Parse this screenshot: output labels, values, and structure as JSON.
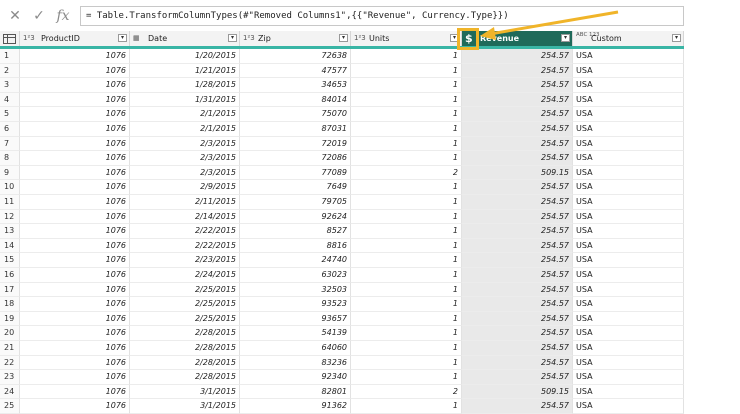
{
  "formula": {
    "cancel_glyph": "✕",
    "commit_glyph": "✓",
    "fx_label": "fx",
    "text": "= Table.TransformColumnTypes(#\"Removed Columns1\",{{\"Revenue\", Currency.Type}})"
  },
  "columns": [
    {
      "type_icon": "1²3",
      "name": "ProductID"
    },
    {
      "type_icon": "▦",
      "name": "Date"
    },
    {
      "type_icon": "1²3",
      "name": "Zip"
    },
    {
      "type_icon": "1²3",
      "name": "Units"
    },
    {
      "type_icon": "$",
      "name": "Revenue"
    },
    {
      "type_icon": "ABC 123",
      "name": "Custom"
    }
  ],
  "accent_color": "#39b5a5",
  "selected_header_color": "#1f6a5a",
  "callout_color": "#f0b429",
  "rows": [
    [
      "1",
      "1076",
      "1/20/2015",
      "72638",
      "1",
      "254.57",
      "USA"
    ],
    [
      "2",
      "1076",
      "1/21/2015",
      "47577",
      "1",
      "254.57",
      "USA"
    ],
    [
      "3",
      "1076",
      "1/28/2015",
      "34653",
      "1",
      "254.57",
      "USA"
    ],
    [
      "4",
      "1076",
      "1/31/2015",
      "84014",
      "1",
      "254.57",
      "USA"
    ],
    [
      "5",
      "1076",
      "2/1/2015",
      "75070",
      "1",
      "254.57",
      "USA"
    ],
    [
      "6",
      "1076",
      "2/1/2015",
      "87031",
      "1",
      "254.57",
      "USA"
    ],
    [
      "7",
      "1076",
      "2/3/2015",
      "72019",
      "1",
      "254.57",
      "USA"
    ],
    [
      "8",
      "1076",
      "2/3/2015",
      "72086",
      "1",
      "254.57",
      "USA"
    ],
    [
      "9",
      "1076",
      "2/3/2015",
      "77089",
      "2",
      "509.15",
      "USA"
    ],
    [
      "10",
      "1076",
      "2/9/2015",
      "7649",
      "1",
      "254.57",
      "USA"
    ],
    [
      "11",
      "1076",
      "2/11/2015",
      "79705",
      "1",
      "254.57",
      "USA"
    ],
    [
      "12",
      "1076",
      "2/14/2015",
      "92624",
      "1",
      "254.57",
      "USA"
    ],
    [
      "13",
      "1076",
      "2/22/2015",
      "8527",
      "1",
      "254.57",
      "USA"
    ],
    [
      "14",
      "1076",
      "2/22/2015",
      "8816",
      "1",
      "254.57",
      "USA"
    ],
    [
      "15",
      "1076",
      "2/23/2015",
      "24740",
      "1",
      "254.57",
      "USA"
    ],
    [
      "16",
      "1076",
      "2/24/2015",
      "63023",
      "1",
      "254.57",
      "USA"
    ],
    [
      "17",
      "1076",
      "2/25/2015",
      "32503",
      "1",
      "254.57",
      "USA"
    ],
    [
      "18",
      "1076",
      "2/25/2015",
      "93523",
      "1",
      "254.57",
      "USA"
    ],
    [
      "19",
      "1076",
      "2/25/2015",
      "93657",
      "1",
      "254.57",
      "USA"
    ],
    [
      "20",
      "1076",
      "2/28/2015",
      "54139",
      "1",
      "254.57",
      "USA"
    ],
    [
      "21",
      "1076",
      "2/28/2015",
      "64060",
      "1",
      "254.57",
      "USA"
    ],
    [
      "22",
      "1076",
      "2/28/2015",
      "83236",
      "1",
      "254.57",
      "USA"
    ],
    [
      "23",
      "1076",
      "2/28/2015",
      "92340",
      "1",
      "254.57",
      "USA"
    ],
    [
      "24",
      "1076",
      "3/1/2015",
      "82801",
      "2",
      "509.15",
      "USA"
    ],
    [
      "25",
      "1076",
      "3/1/2015",
      "91362",
      "1",
      "254.57",
      "USA"
    ]
  ]
}
